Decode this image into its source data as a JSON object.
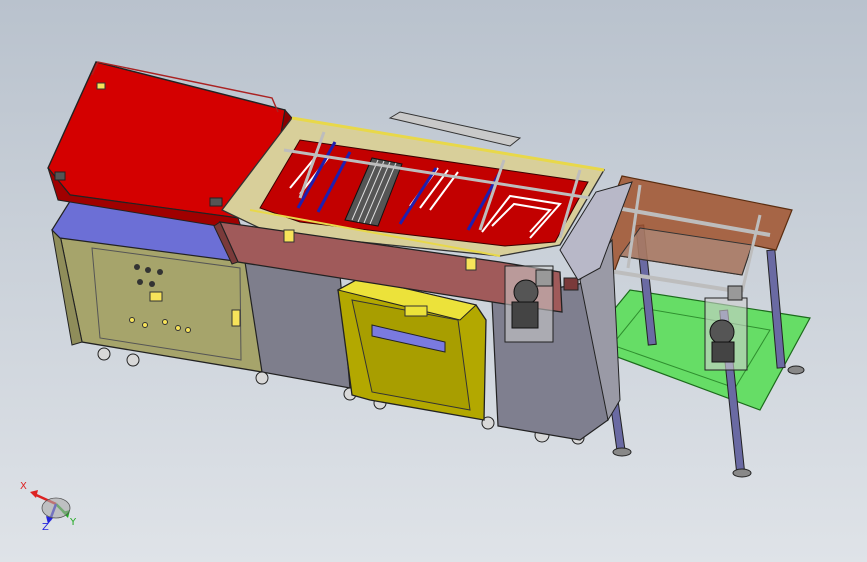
{
  "colors": {
    "background_top": "#b9c2cd",
    "background_bottom": "#dfe3e8",
    "hood_red": "#d40000",
    "trough_red": "#c20000",
    "cabinet_olive": "#a6a46b",
    "cabinet_blue": "#6c6fd6",
    "bin_yellow": "#b3a800",
    "frame_brown": "#a0522d",
    "platform_green": "#66dd66",
    "legs_blue": "#6a6aa3",
    "outline": "#222222"
  },
  "axis_triad": {
    "x_label": "X",
    "y_label": "Y",
    "z_label": "Z"
  }
}
